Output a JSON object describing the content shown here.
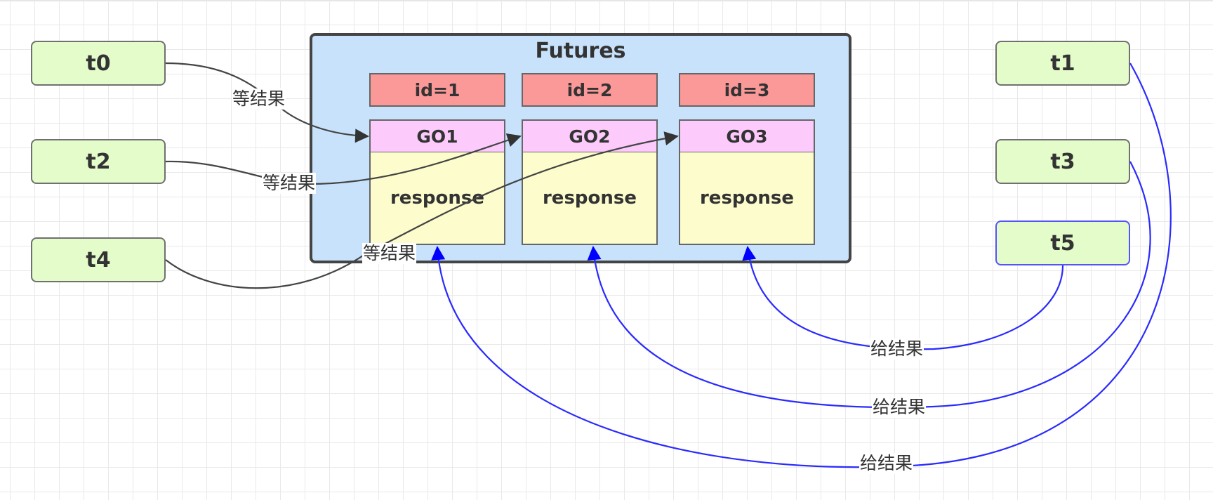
{
  "diagram": {
    "container": {
      "title": "Futures"
    },
    "futures": [
      {
        "id_label": "id=1",
        "go_label": "GO1",
        "body_label": "response"
      },
      {
        "id_label": "id=2",
        "go_label": "GO2",
        "body_label": "response"
      },
      {
        "id_label": "id=3",
        "go_label": "GO3",
        "body_label": "response"
      }
    ],
    "waiting_threads": [
      {
        "label": "t0"
      },
      {
        "label": "t2"
      },
      {
        "label": "t4"
      }
    ],
    "producer_threads": [
      {
        "label": "t1"
      },
      {
        "label": "t3"
      },
      {
        "label": "t5"
      }
    ],
    "edges": [
      {
        "from": "t0",
        "to": "GO1",
        "label": "等结果",
        "color": "#333333"
      },
      {
        "from": "t2",
        "to": "GO2",
        "label": "等结果",
        "color": "#333333"
      },
      {
        "from": "t4",
        "to": "GO3",
        "label": "等结果",
        "color": "#333333"
      },
      {
        "from": "t5",
        "to": "GO3",
        "label": "给结果",
        "color": "#0000ff"
      },
      {
        "from": "t3",
        "to": "GO2",
        "label": "给结果",
        "color": "#0000ff"
      },
      {
        "from": "t1",
        "to": "GO1",
        "label": "给结果",
        "color": "#0000ff"
      }
    ],
    "colors": {
      "thread_fill": "#e3fcc9",
      "container_fill": "#c8e2fc",
      "id_fill": "#fb9898",
      "go_fill": "#fccbfc",
      "response_fill": "#fdfccd",
      "wait_edge": "#333333",
      "give_edge": "#0000ff"
    }
  }
}
